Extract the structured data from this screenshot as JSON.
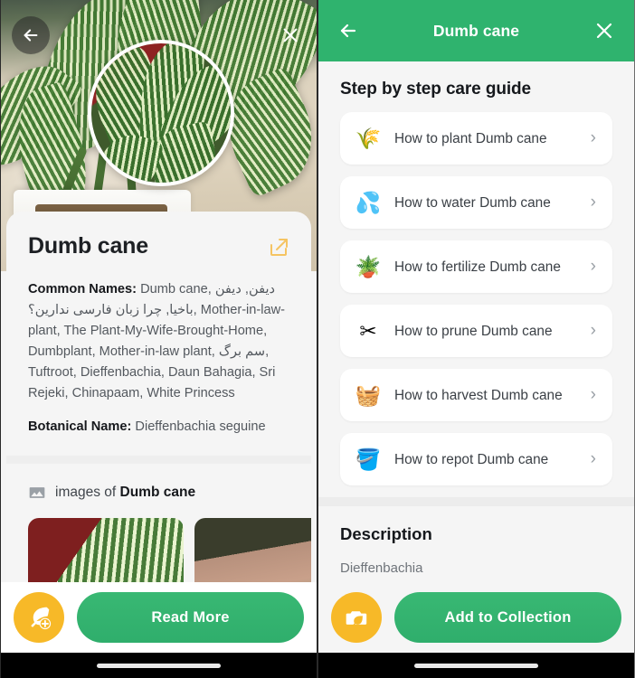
{
  "left_panel": {
    "back_icon": "arrow-left-icon",
    "close_icon": "close-icon",
    "share_icon": "share-icon",
    "plant_title": "Dumb cane",
    "common_names_label": "Common Names:",
    "common_names_value": " Dumb cane, دیفن, دیفن باخیا, چرا زبان فارسی ندارین؟, Mother-in-law-plant, The Plant-My-Wife-Brought-Home, Dumbplant, Mother-in-law plant, سم برگ, Tuftroot, Dieffenbachia, Daun Bahagia, Sri Rejeki, Chinapaam, White Princess",
    "botanical_label": "Botanical Name:",
    "botanical_value": " Dieffenbachia seguine",
    "images_icon": "image-icon",
    "images_prefix": "images of ",
    "images_plant": "Dumb cane",
    "thumbnails": [
      {
        "name": "thumbnail-1"
      },
      {
        "name": "thumbnail-2"
      },
      {
        "name": "thumbnail-3"
      }
    ],
    "fab_icon": "leaf-plus-icon",
    "primary_button": "Read More"
  },
  "right_panel": {
    "back_icon": "arrow-left-icon",
    "close_icon": "close-icon",
    "app_bar_title": "Dumb cane",
    "guide_title": "Step by step care guide",
    "guide_items": [
      {
        "emoji": "🌾",
        "icon_name": "potted-sprout-icon",
        "label": "How to plant Dumb cane"
      },
      {
        "emoji": "💦",
        "icon_name": "water-drop-icon",
        "label": "How to water Dumb cane"
      },
      {
        "emoji": "🪴",
        "icon_name": "fertilizer-bag-icon",
        "label": "How to fertilize Dumb cane"
      },
      {
        "emoji": "✂",
        "icon_name": "pruning-shears-icon",
        "label": "How to prune Dumb cane"
      },
      {
        "emoji": "🧺",
        "icon_name": "harvest-basket-icon",
        "label": "How to harvest Dumb cane"
      },
      {
        "emoji": "🪣",
        "icon_name": "repot-bucket-icon",
        "label": "How to repot Dumb cane"
      }
    ],
    "chevron_glyph": "›",
    "description_title": "Description",
    "description_body": "Dieffenbachia",
    "fab_icon": "photo-leaf-icon",
    "primary_button": "Add to Collection"
  },
  "colors": {
    "brand_green": "#2fb36e",
    "button_green": "#34b271",
    "fab_yellow": "#f7b928",
    "surface": "#f5f5f5",
    "card": "#ffffff",
    "text_primary": "#15181c",
    "text_secondary": "#53585e"
  }
}
